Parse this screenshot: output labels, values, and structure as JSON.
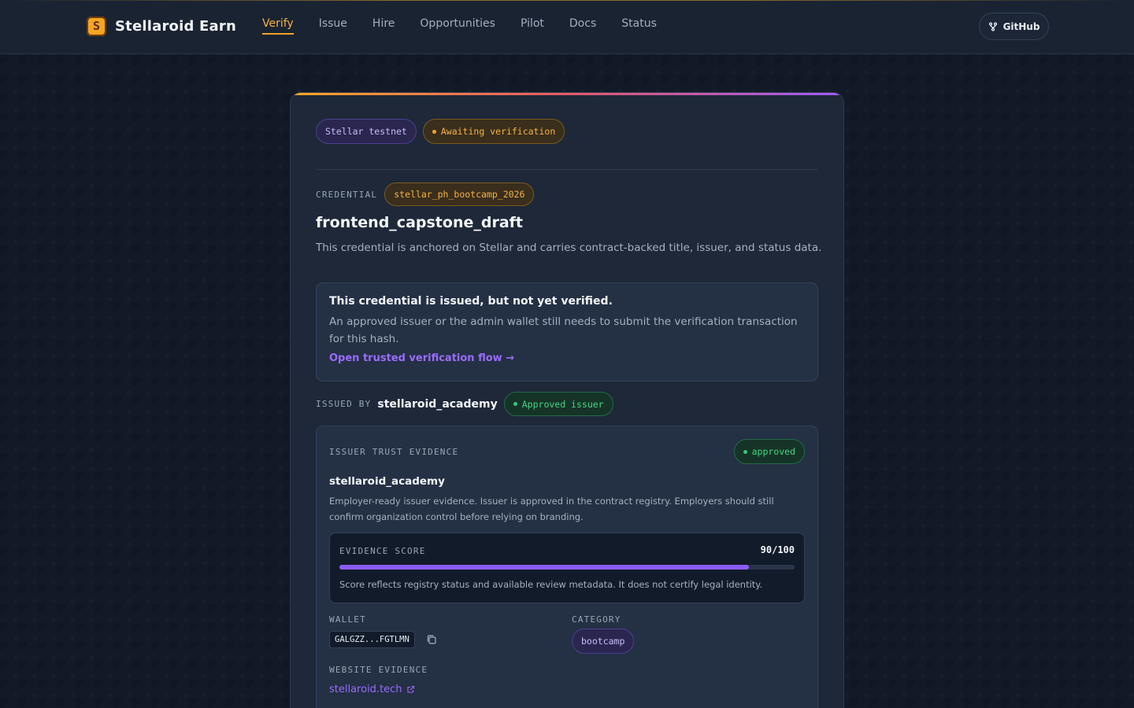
{
  "header": {
    "logo_glyph": "S",
    "brand": "Stellaroid Earn",
    "nav": [
      {
        "label": "Verify",
        "active": true
      },
      {
        "label": "Issue"
      },
      {
        "label": "Hire"
      },
      {
        "label": "Opportunities"
      },
      {
        "label": "Pilot"
      },
      {
        "label": "Docs"
      },
      {
        "label": "Status"
      }
    ],
    "github_label": "GitHub",
    "github_icon": "git-branch-icon"
  },
  "badges": {
    "network": "Stellar testnet",
    "status": "Awaiting verification"
  },
  "credential": {
    "label": "CREDENTIAL",
    "program": "stellar_ph_bootcamp_2026",
    "title": "frontend_capstone_draft",
    "description": "This credential is anchored on Stellar and carries contract-backed title, issuer, and status data."
  },
  "notice": {
    "title": "This credential is issued, but not yet verified.",
    "body": "An approved issuer or the admin wallet still needs to submit the verification transaction for this hash.",
    "link": "Open trusted verification flow →"
  },
  "issued_by": {
    "label": "ISSUED BY",
    "issuer": "stellaroid_academy",
    "badge": "Approved issuer"
  },
  "trust": {
    "label": "ISSUER TRUST EVIDENCE",
    "status": "approved",
    "name": "stellaroid_academy",
    "description": "Employer-ready issuer evidence. Issuer is approved in the contract registry. Employers should still confirm organization control before relying on branding.",
    "score_label": "EVIDENCE SCORE",
    "score_display": "90/100",
    "score_fraction": 0.9,
    "score_note": "Score reflects registry status and available review metadata. It does not certify legal identity.",
    "wallet_label": "WALLET",
    "wallet": "GALGZZ...FGTLMN",
    "category_label": "CATEGORY",
    "category": "bootcamp",
    "website_label": "WEBSITE EVIDENCE",
    "website": "stellaroid.tech"
  },
  "colors": {
    "accent_orange": "#f5a524",
    "accent_purple": "#8b5cf6",
    "success_green": "#34c77a"
  }
}
